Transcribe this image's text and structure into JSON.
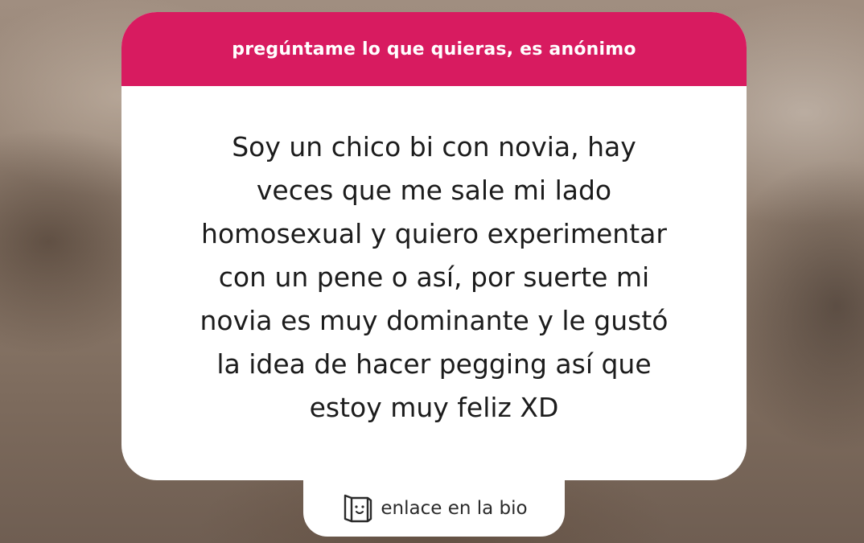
{
  "header": {
    "prompt": "pregúntame lo que quieras, es anónimo"
  },
  "question": {
    "text": "Soy un chico bi con novia, hay\nveces que me sale mi lado\nhomosexual y quiero experimentar\ncon un pene o así, por suerte mi\nnovia es muy dominante y le gustó\nla idea de hacer pegging así que\nestoy muy feliz XD"
  },
  "footer": {
    "icon": "bag-face-icon",
    "link_text": "enlace en la bio"
  },
  "colors": {
    "header_bg": "#d81b60",
    "card_bg": "#ffffff",
    "text": "#1c1c1c"
  }
}
